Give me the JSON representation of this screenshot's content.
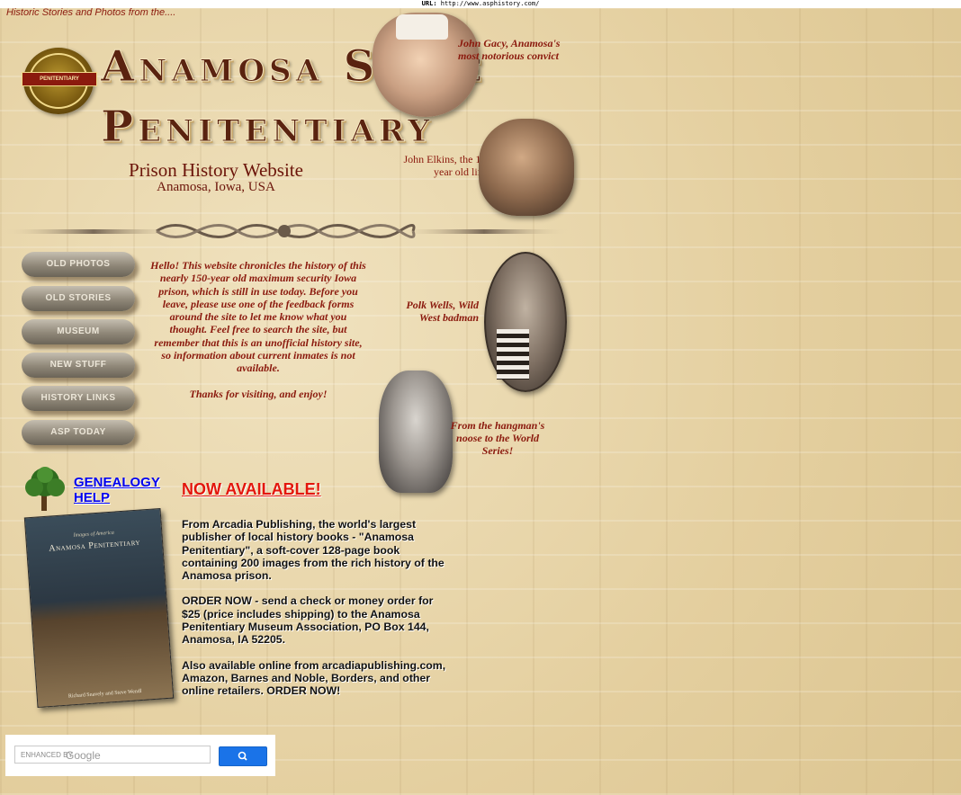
{
  "url_bar": {
    "label": "URL:",
    "value": "http://www.asphistory.com/"
  },
  "header": {
    "tagline": "Historic Stories and Photos from the....",
    "title_line1": "Anamosa State",
    "title_line2": "Penitentiary",
    "subtitle": "Prison History Website",
    "location": "Anamosa, Iowa, USA",
    "seal_text": "PENITENTIARY"
  },
  "photos": [
    {
      "caption": "John Gacy, Anamosa's most notorious convict"
    },
    {
      "caption": "John Elkins, the 11-year old lifer"
    },
    {
      "caption": "Polk Wells, Wild West badman"
    },
    {
      "caption": "From the hangman's noose to the World Series!"
    }
  ],
  "nav": {
    "items": [
      "OLD PHOTOS",
      "OLD STORIES",
      "MUSEUM",
      "NEW STUFF",
      "HISTORY LINKS",
      "ASP TODAY"
    ]
  },
  "intro": {
    "paragraph": "Hello!  This website chronicles the history of this nearly 150-year old maximum security Iowa prison, which is still in use today. Before you leave, please use one of the feedback forms around the site to let me know what you thought. Feel free to search the site, but remember that this is an unofficial history site, so information about current inmates is not available.",
    "thanks": "Thanks for visiting, and enjoy!"
  },
  "genealogy": {
    "line1": "GENEALOGY",
    "line2": "HELP"
  },
  "book": {
    "series": "Images of America",
    "title": "Anamosa Penitentiary",
    "authors": "Richard Snavely and Steve Wendl"
  },
  "promo": {
    "headline": "NOW AVAILABLE!",
    "p1": "From Arcadia Publishing, the world's largest publisher of local history books - \"Anamosa Penitentiary\", a soft-cover 128-page book containing 200 images from the rich history of the Anamosa prison.",
    "p2": "ORDER NOW - send a check or money order for $25 (price includes shipping) to the Anamosa Penitentiary Museum Association, PO Box 144, Anamosa, IA  52205.",
    "p3": "Also available online from arcadiapublishing.com, Amazon, Barnes and Noble, Borders, and other online retailers.  ORDER NOW!"
  },
  "search": {
    "enhanced_label": "ENHANCED BY",
    "brand": "Google"
  },
  "colors": {
    "accent": "#8b1a0e",
    "link": "#0000ee",
    "alert": "#e3160b",
    "search_button": "#1a73e8"
  }
}
